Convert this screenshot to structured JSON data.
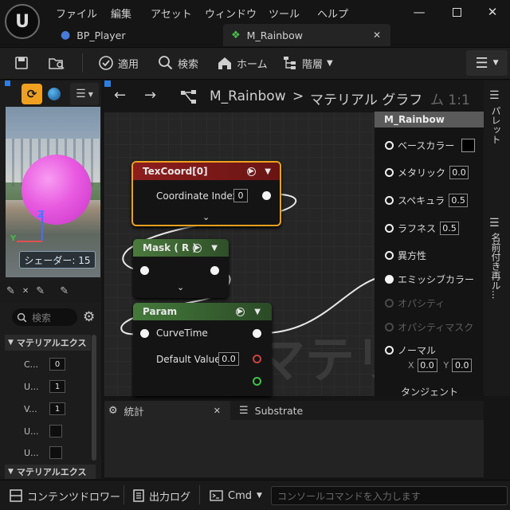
{
  "app": {
    "logo": "U"
  },
  "menu": [
    "ファイル",
    "編集",
    "アセット",
    "ウィンドウ",
    "ツール",
    "ヘルプ"
  ],
  "tabs": [
    {
      "label": "BP_Player"
    },
    {
      "label": "M_Rainbow"
    }
  ],
  "toolbar": {
    "apply": "適用",
    "search": "検索",
    "home": "ホーム",
    "hierarchy": "階層"
  },
  "preview": {
    "axis_z": "Z",
    "axis_y": "Y",
    "shader_count": "シェーダー: 15"
  },
  "details": {
    "search_placeholder": "検索",
    "section1": "マテリアルエクス",
    "rows": [
      {
        "label": "C...",
        "value": "0"
      },
      {
        "label": "U...",
        "value": "1"
      },
      {
        "label": "V...",
        "value": "1"
      },
      {
        "label": "U...",
        "value": ""
      },
      {
        "label": "U...",
        "value": ""
      }
    ],
    "section2": "マテリアルエクス"
  },
  "graph": {
    "breadcrumb_asset": "M_Rainbow",
    "breadcrumb_sep": ">",
    "breadcrumb_graph": "マテリアル グラフ",
    "zoom": "ム 1:1",
    "watermark": "マテリアル",
    "nodes": {
      "texcoord": {
        "title": "TexCoord[0]",
        "prop": "Coordinate Index",
        "value": "0"
      },
      "mask": {
        "title": "Mask ( R )"
      },
      "param": {
        "title": "Param",
        "output": "CurveTime",
        "prop": "Default Value",
        "value": "0.0"
      }
    },
    "result": {
      "title": "M_Rainbow",
      "base_color": "ベースカラー",
      "metallic": "メタリック",
      "metallic_value": "0.0",
      "specular": "スペキュラ",
      "specular_value": "0.5",
      "roughness": "ラフネス",
      "roughness_value": "0.5",
      "anisotropy": "異方性",
      "emissive": "エミッシブカラー",
      "opacity": "オパシティ",
      "opacity_mask": "オパシティマスク",
      "normal": "ノーマル",
      "normal_x_label": "X",
      "normal_x": "0.0",
      "normal_y_label": "Y",
      "normal_y": "0.0",
      "tangent": "タンジェント"
    }
  },
  "right_sidebar": {
    "palette": "パレット",
    "named_reroute": "名前付き再ル..."
  },
  "bottom": {
    "stats_tab": "統計",
    "substrate_tab": "Substrate"
  },
  "status": {
    "content_drawer": "コンテンツドロワー",
    "output_log": "出力ログ",
    "cmd": "Cmd",
    "console_placeholder": "コンソールコマンドを入力します"
  },
  "colors": {
    "accent_orange": "#f0a020",
    "texcoord_header": "#8e1e1e",
    "mask_header": "#3f6a34",
    "param_header": "#3b6b33",
    "sphere": "#e85ae0"
  }
}
